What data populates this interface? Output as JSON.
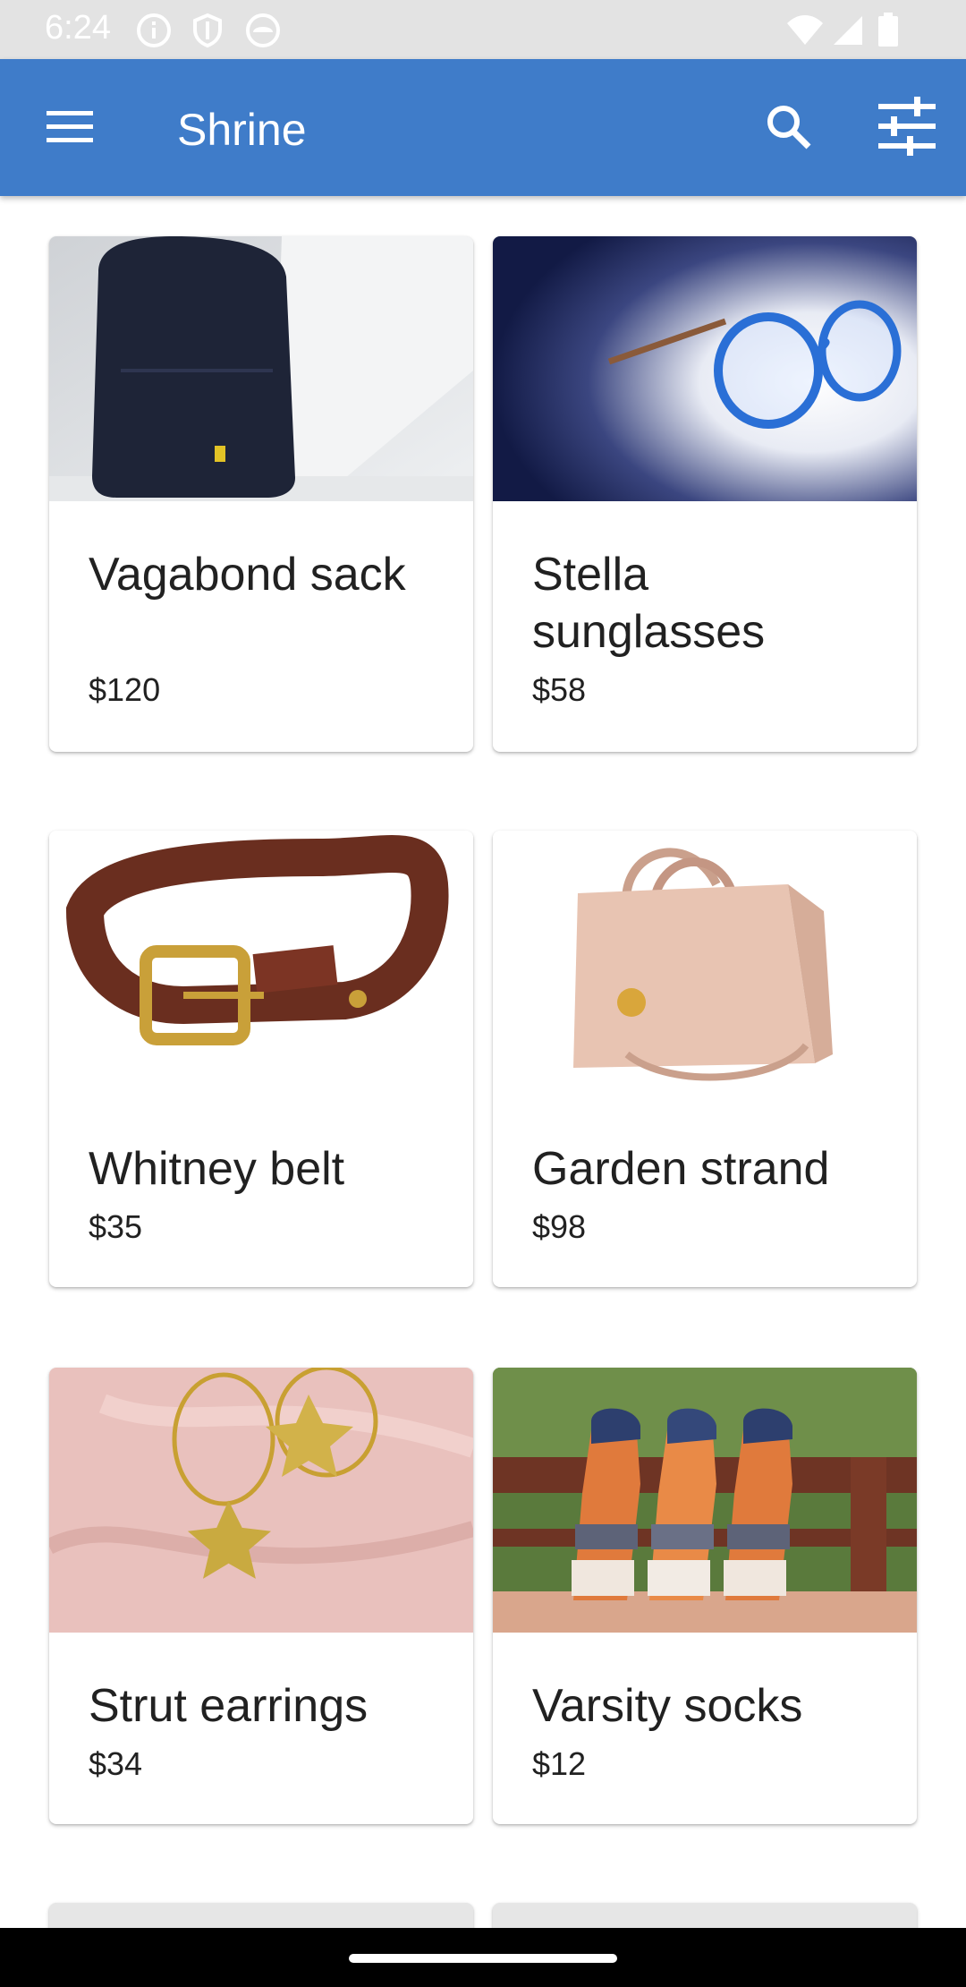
{
  "status_bar": {
    "time": "6:24",
    "icons": [
      "info-icon",
      "shield-icon",
      "android-icon",
      "wifi-icon",
      "signal-icon",
      "battery-icon"
    ]
  },
  "app_bar": {
    "title": "Shrine",
    "menu_icon": "menu-icon",
    "search_icon": "search-icon",
    "filter_icon": "tune-icon",
    "color": "#3f7cc9"
  },
  "products": [
    {
      "name": "Vagabond sack",
      "price": "$120",
      "image": "backpack"
    },
    {
      "name": "Stella sunglasses",
      "price": "$58",
      "image": "glasses"
    },
    {
      "name": "Whitney belt",
      "price": "$35",
      "image": "belt"
    },
    {
      "name": "Garden strand",
      "price": "$98",
      "image": "handbag"
    },
    {
      "name": "Strut earrings",
      "price": "$34",
      "image": "earrings"
    },
    {
      "name": "Varsity socks",
      "price": "$12",
      "image": "socks"
    }
  ]
}
